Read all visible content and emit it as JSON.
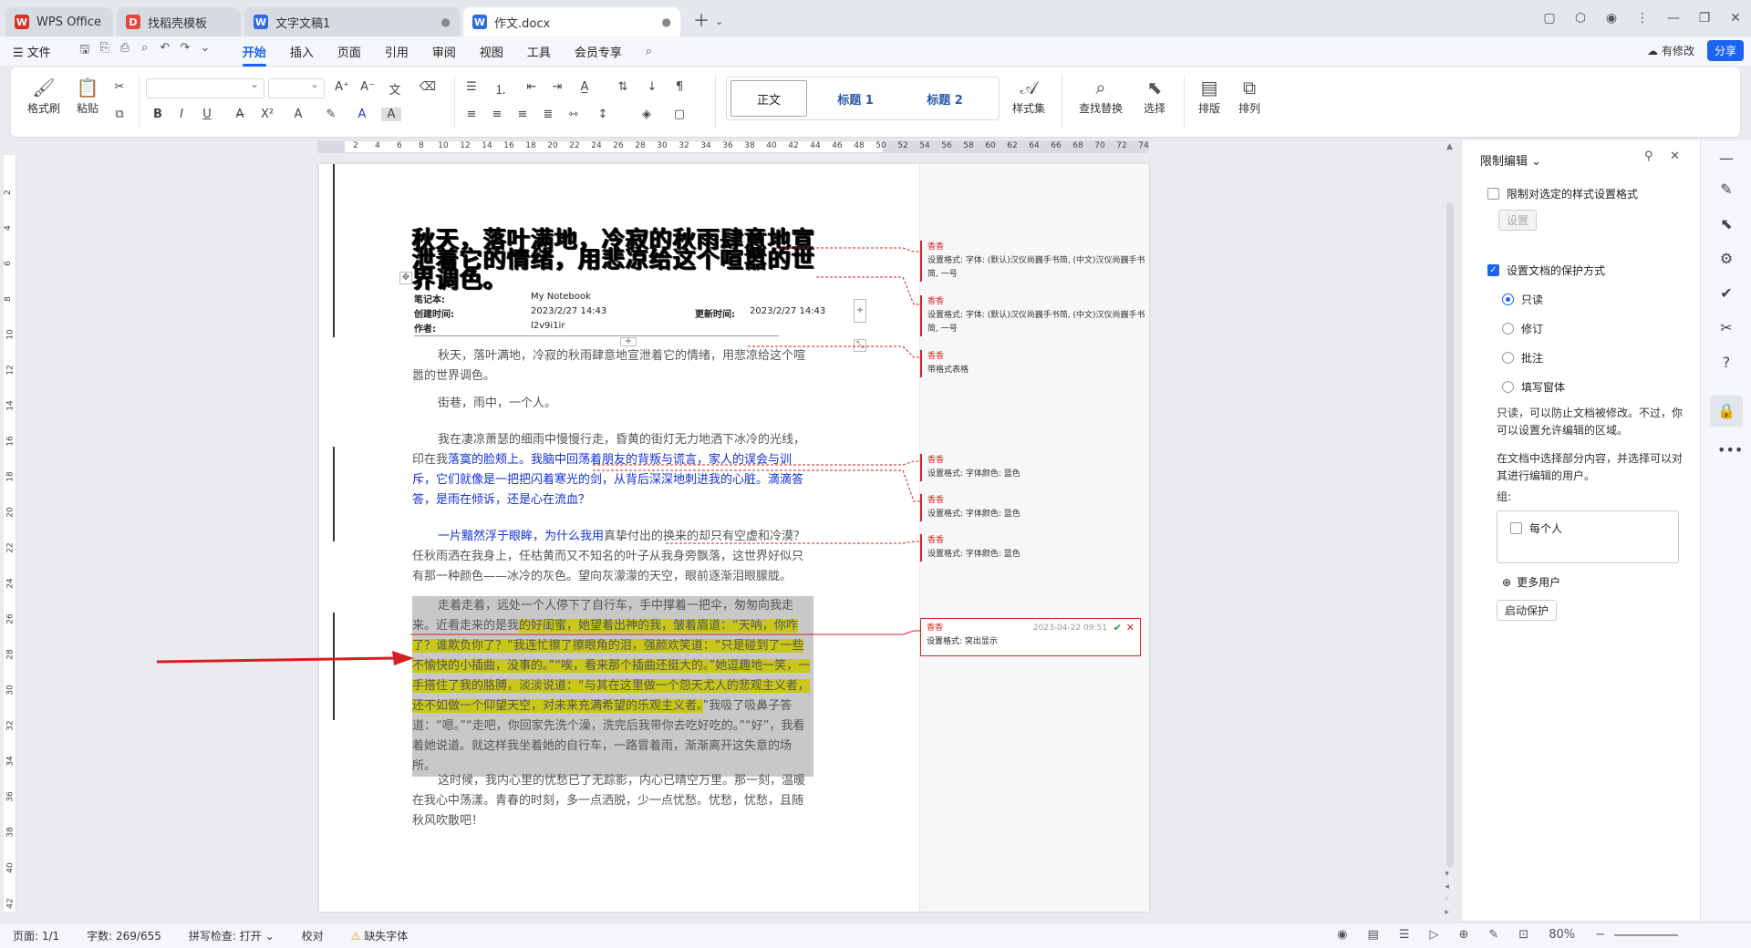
{
  "tabs": [
    {
      "label": "WPS Office",
      "icon": "wps-logo-icon",
      "color": "#d93025"
    },
    {
      "label": "找稻壳模板",
      "icon": "docer-icon",
      "color": "#e8453c"
    },
    {
      "label": "文字文稿1",
      "icon": "writer-icon",
      "color": "#2f6bdf"
    },
    {
      "label": "作文.docx",
      "icon": "writer-icon",
      "color": "#2f6bdf"
    }
  ],
  "menu": {
    "file": "☰ 文件",
    "items": [
      "开始",
      "插入",
      "页面",
      "引用",
      "审阅",
      "视图",
      "工具",
      "会员专享"
    ],
    "active": "开始",
    "revise": "有修改",
    "share": "分享"
  },
  "ribbon": {
    "format_painter": "格式刷",
    "paste": "粘贴",
    "styles": [
      "正文",
      "标题 1",
      "标题 2"
    ],
    "style_set": "样式集",
    "find_replace": "查找替换",
    "select": "选择",
    "layout": "排版",
    "arrange": "排列"
  },
  "ruler_h": [
    "2",
    "4",
    "6",
    "8",
    "10",
    "12",
    "14",
    "16",
    "18",
    "20",
    "22",
    "24",
    "26",
    "28",
    "30",
    "32",
    "34",
    "36",
    "38",
    "40",
    "42",
    "44",
    "46",
    "48",
    "50",
    "52",
    "54",
    "56",
    "58",
    "60",
    "62",
    "64",
    "66",
    "68",
    "70",
    "72",
    "74"
  ],
  "ruler_v": [
    "2",
    "4",
    "6",
    "8",
    "10",
    "12",
    "14",
    "16",
    "18",
    "20",
    "22",
    "24",
    "26",
    "28",
    "30",
    "32",
    "34",
    "36",
    "38",
    "40",
    "42"
  ],
  "document": {
    "title": "秋天，落叶满地，冷寂的秋雨肆意地宣泄着它的情绪，用悲凉给这个喧嚣的世界调色。",
    "meta": {
      "notebook_label": "笔记本:",
      "notebook_value": "My Notebook",
      "created_label": "创建时间:",
      "created_value": "2023/2/27 14:43",
      "updated_label": "更新时间:",
      "updated_value": "2023/2/27 14:43",
      "author_label": "作者:",
      "author_value": "l2v9i1ir"
    },
    "p1": "秋天，落叶满地，冷寂的秋雨肆意地宣泄着它的情绪，用悲凉给这个喧嚣的世界调色。",
    "p2": "街巷，雨中，一个人。",
    "p3_a": "我在凄凉萧瑟的细雨中慢慢行走，昏黄的街灯无力地洒下冰冷的光线，印在我",
    "p3_b": "落寞的脸颊上。我脑中回荡着朋友的背叛与谎言，家人的误会与训斥，它们就像是一把把闪着寒光的剑，从背后深深地刺进我的心脏。滴滴答答，是雨在倾诉，还是心在流血？",
    "p4_a": "一片黯然浮于眼眸，为什么我用",
    "p4_b": "真挚付出的换来的却只有空虚和冷漠？任秋雨洒在我身上，任枯黄而又不知名的叶子从我身旁飘落，这世界好似只有那一种颜色——冰冷的灰色。望向灰濛濛的天空，眼前逐渐泪眼朦胧。",
    "p5_a": "走着走着，远处一个人停下了自行车，手中撑着一把伞，匆匆向我走来。近看走来的是我",
    "p5_b": "的好闺蜜，她望着出神的我，皱着眉道：“天呐，你咋了？谁欺负你了？”我连忙擦了擦眼角的泪，强颜欢笑道：“只是碰到了一些不愉快的小插曲，没事的。”“唉，看来那个插曲还挺大的。”她逗趣地一笑，一手搭住了我的胳膊，淡淡说道：“与其在这里做一个怨天尤人的悲观主义者，还不如做一个仰望天空，对未来充满希望的乐观主义者。",
    "p5_c": "”我吸了吸鼻子答道：“嗯。”“走吧，你回家先洗个澡，洗完后我带你去吃好吃的。”“好”，我看着她说道。就这样我坐着她的自行车，一路冒着雨，渐渐离开这失意的场所。",
    "p6": "这时候，我内心里的忧愁已了无踪影，内心已晴空万里。那一刻，温暖在我心中荡漾。青春的时刻，多一点洒脱，少一点忧愁。忧愁，忧愁，且随秋风吹散吧！"
  },
  "comments": [
    {
      "author": "香香",
      "text": "设置格式: 字体: (默认)汉仪尚巍手书简, (中文)汉仪尚巍手书简, 一号"
    },
    {
      "author": "香香",
      "text": "设置格式: 字体: (默认)汉仪尚巍手书简, (中文)汉仪尚巍手书简, 一号"
    },
    {
      "author": "香香",
      "text": "带格式表格"
    },
    {
      "author": "香香",
      "text": "设置格式: 字体颜色: 蓝色"
    },
    {
      "author": "香香",
      "text": "设置格式: 字体颜色: 蓝色"
    },
    {
      "author": "香香",
      "text": "设置格式: 字体颜色: 蓝色"
    },
    {
      "author": "香香",
      "text": "设置格式: 突出显示",
      "time": "2023-04-22 09:51"
    }
  ],
  "panel": {
    "title": "限制编辑",
    "limit_format": "限制对选定的样式设置格式",
    "settings_btn": "设置",
    "protect_label": "设置文档的保护方式",
    "options": [
      "只读",
      "修订",
      "批注",
      "填写窗体"
    ],
    "selected": "只读",
    "desc1": "只读，可以防止文档被修改。不过，你可以设置允许编辑的区域。",
    "desc2": "在文档中选择部分内容，并选择可以对其进行编辑的用户。",
    "group_label": "组:",
    "everyone": "每个人",
    "more_users": "更多用户",
    "start_protect": "启动保护"
  },
  "status": {
    "page": "页面: 1/1",
    "words": "字数: 269/655",
    "spell": "拼写检查: 打开 ⌄",
    "proof": "校对",
    "missing_font": "缺失字体",
    "zoom": "80%"
  },
  "colors": {
    "accent": "#1b64f0",
    "revision": "#d42020",
    "highlight": "#c9c81a",
    "blue_text": "#1530d8"
  }
}
